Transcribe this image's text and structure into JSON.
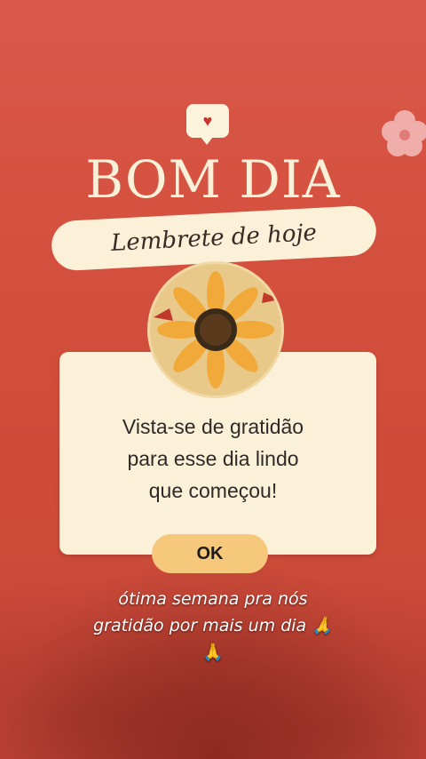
{
  "header": {
    "title": "BOM DIA",
    "subtitle": "Lembrete de hoje"
  },
  "dialog": {
    "message_lines": [
      "Vista-se de gratidão",
      "para esse dia lindo",
      "que começou!"
    ],
    "ok_label": "OK"
  },
  "caption": {
    "lines": [
      "ótima semana pra nós",
      "gratidão por mais um dia 🙏",
      "🙏"
    ]
  },
  "icons": {
    "heart": "heart-icon",
    "flower": "flower-icon",
    "sunflower": "sunflower-image"
  },
  "colors": {
    "background": "#d4503e",
    "card": "#fbf1d8",
    "button": "#f6c87b"
  }
}
